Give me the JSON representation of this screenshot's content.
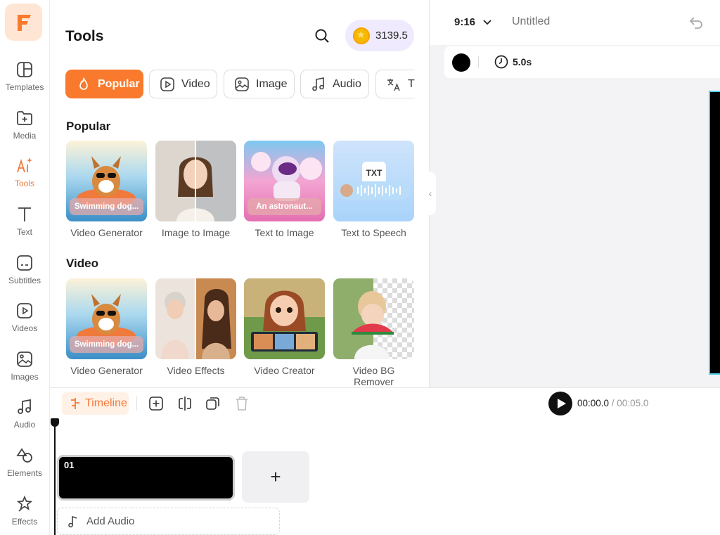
{
  "rail": {
    "items": [
      {
        "label": "Templates",
        "icon": "templates-icon"
      },
      {
        "label": "Media",
        "icon": "media-icon"
      },
      {
        "label": "Tools",
        "icon": "ai-tools-icon"
      },
      {
        "label": "Text",
        "icon": "text-icon"
      },
      {
        "label": "Subtitles",
        "icon": "subtitles-icon"
      },
      {
        "label": "Videos",
        "icon": "videos-icon"
      },
      {
        "label": "Images",
        "icon": "images-icon"
      },
      {
        "label": "Audio",
        "icon": "audio-icon"
      },
      {
        "label": "Elements",
        "icon": "elements-icon"
      },
      {
        "label": "Effects",
        "icon": "effects-icon"
      }
    ],
    "active": "Tools",
    "accent": "#f4793b"
  },
  "panel": {
    "title": "Tools",
    "coins": "3139.5",
    "chips": [
      {
        "label": "Popular"
      },
      {
        "label": "Video"
      },
      {
        "label": "Image"
      },
      {
        "label": "Audio"
      },
      {
        "label": "Tr"
      }
    ],
    "sections": [
      {
        "title": "Popular",
        "cards": [
          {
            "label": "Video Generator",
            "overlay": "Swimming dog..."
          },
          {
            "label": "Image to Image",
            "overlay": ""
          },
          {
            "label": "Text to Image",
            "overlay": "An astronaut..."
          },
          {
            "label": "Text to Speech",
            "overlay": "TXT"
          }
        ]
      },
      {
        "title": "Video",
        "cards": [
          {
            "label": "Video Generator",
            "overlay": "Swimming dog..."
          },
          {
            "label": "Video Effects",
            "overlay": ""
          },
          {
            "label": "Video Creator",
            "overlay": ""
          },
          {
            "label": "Video BG Remover",
            "overlay": ""
          }
        ]
      }
    ]
  },
  "preview": {
    "ratio": "9:16",
    "doc_title": "Untitled",
    "duration": "5.0s",
    "fill_color": "#000000"
  },
  "timeline": {
    "label": "Timeline",
    "current_time": "00:00.0",
    "total_time": " / 00:05.0",
    "clip_number": "01",
    "add_clip": "+",
    "add_audio": "Add Audio"
  }
}
